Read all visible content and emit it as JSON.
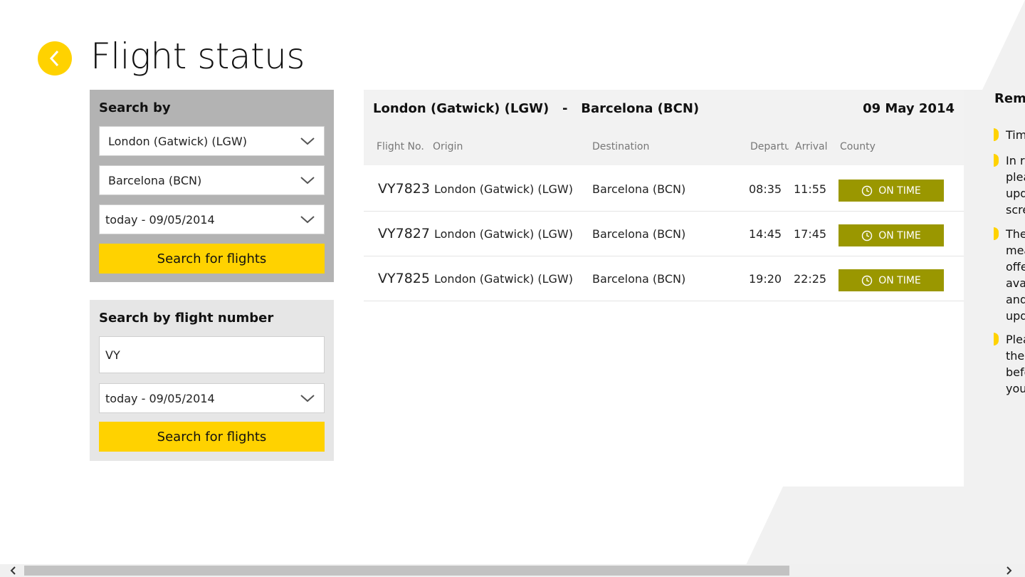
{
  "page": {
    "title": "Flight status"
  },
  "search_by": {
    "title": "Search by",
    "origin": "London (Gatwick) (LGW)",
    "destination": "Barcelona (BCN)",
    "date": "today - 09/05/2014",
    "button": "Search for flights"
  },
  "search_by_number": {
    "title": "Search by flight number",
    "flight_input": "VY",
    "date": "today - 09/05/2014",
    "button": "Search for flights"
  },
  "results": {
    "route": "London (Gatwick) (LGW)   -   Barcelona (BCN)",
    "date": "09 May 2014",
    "columns": [
      "Flight No.",
      "Origin",
      "Destination",
      "Departu",
      "Arrival",
      "County"
    ],
    "rows": [
      {
        "flight": "VY7823",
        "origin": "London (Gatwick) (LGW)",
        "destination": "Barcelona (BCN)",
        "departure": "08:35",
        "arrival": "11:55",
        "status": "ON TIME"
      },
      {
        "flight": "VY7827",
        "origin": "London (Gatwick) (LGW)",
        "destination": "Barcelona (BCN)",
        "departure": "14:45",
        "arrival": "17:45",
        "status": "ON TIME"
      },
      {
        "flight": "VY7825",
        "origin": "London (Gatwick) (LGW)",
        "destination": "Barcelona (BCN)",
        "departure": "19:20",
        "arrival": "22:25",
        "status": "ON TIME"
      }
    ]
  },
  "remember": {
    "title": "Reme",
    "items": [
      {
        "lines": [
          "Tim"
        ]
      },
      {
        "lines": [
          "In r",
          "plea",
          "upd",
          "scre"
        ]
      },
      {
        "lines": [
          "The",
          "mea",
          "offe",
          "ava",
          "and",
          "upd"
        ]
      },
      {
        "lines": [
          "Plea",
          "the",
          "befo",
          "you"
        ]
      }
    ]
  },
  "colors": {
    "accent": "#ffd200",
    "status": "#9a9700",
    "panel_dark": "#b3b3b3",
    "panel_light": "#e6e6e6"
  },
  "icons": {
    "back": "chevron-left-icon",
    "dropdown": "chevron-down-icon",
    "clock": "clock-icon"
  }
}
